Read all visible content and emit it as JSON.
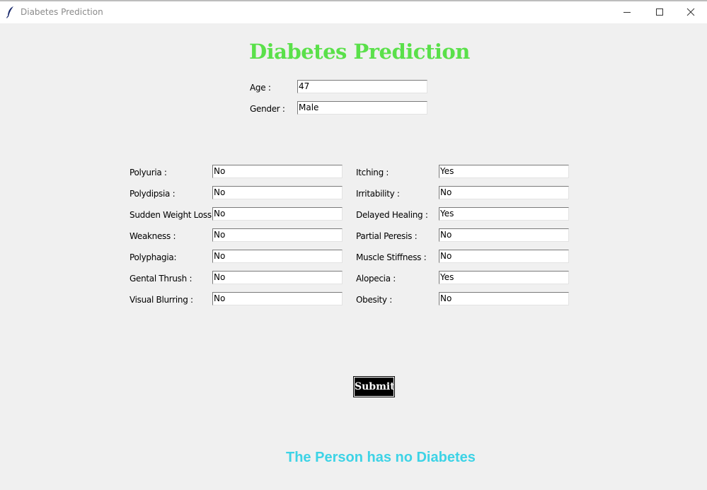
{
  "window": {
    "title": "Diabetes Prediction"
  },
  "header": {
    "title": "Diabetes Prediction"
  },
  "basic": {
    "age_label": "Age :",
    "age_value": "47",
    "gender_label": "Gender :",
    "gender_value": "Male"
  },
  "left": [
    {
      "label": "Polyuria :",
      "value": "No"
    },
    {
      "label": "Polydipsia :",
      "value": "No"
    },
    {
      "label": "Sudden Weight Loss :",
      "value": "No"
    },
    {
      "label": "Weakness :",
      "value": "No"
    },
    {
      "label": "Polyphagia:",
      "value": "No"
    },
    {
      "label": "Gental Thrush :",
      "value": "No"
    },
    {
      "label": "Visual Blurring :",
      "value": "No"
    }
  ],
  "right": [
    {
      "label": "Itching :",
      "value": "Yes"
    },
    {
      "label": "Irritability :",
      "value": "No"
    },
    {
      "label": "Delayed Healing :",
      "value": "Yes"
    },
    {
      "label": "Partial Peresis :",
      "value": "No"
    },
    {
      "label": "Muscle Stiffness :",
      "value": "No"
    },
    {
      "label": "Alopecia :",
      "value": "Yes"
    },
    {
      "label": "Obesity :",
      "value": "No"
    }
  ],
  "actions": {
    "submit_label": "Submit"
  },
  "result": {
    "text": "The Person has no Diabetes",
    "color": "#3dd3e6"
  },
  "colors": {
    "title": "#5ae04a",
    "background": "#f0f0f0"
  }
}
